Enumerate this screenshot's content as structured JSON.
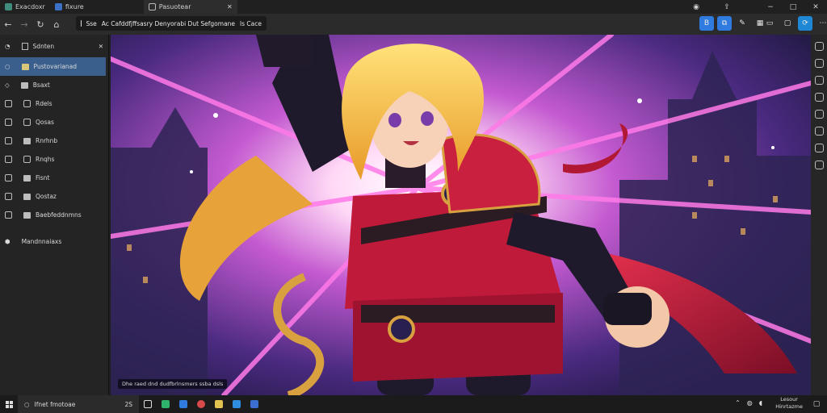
{
  "tabs": [
    {
      "label": "Exacdoxr",
      "active": false
    },
    {
      "label": "fixure",
      "active": false
    },
    {
      "label": "Pasuotear",
      "active": true
    }
  ],
  "tab_close": "✕",
  "window_controls": [
    "−",
    "□",
    "✕"
  ],
  "address": {
    "prefix": "Sse",
    "value": "Ac Cafddfjffsasry Denyorabi Dut Sefgomane",
    "suffix": "ls Cace"
  },
  "sidebar": {
    "header": "Sdnten",
    "items": [
      {
        "label": "Pustovarianad",
        "icon": "folder-icon",
        "selected": true
      },
      {
        "label": "Bsaxt",
        "icon": "pin-icon"
      },
      {
        "label": "Rdels",
        "icon": "file-icon"
      },
      {
        "label": "Qosas",
        "icon": "doc-icon"
      },
      {
        "label": "Rnrhnb",
        "icon": "image-icon"
      },
      {
        "label": "Rnqhs",
        "icon": "doc-icon"
      },
      {
        "label": "Fisnt",
        "icon": "file-icon"
      },
      {
        "label": "Qostaz",
        "icon": "doc-icon"
      },
      {
        "label": "Baebfeddnmns",
        "icon": "image-icon"
      },
      {
        "label": "Mandnnaiaxs",
        "icon": "settings-icon"
      }
    ]
  },
  "viewport_caption": "Dhe raed dnd dudfbrlnsmers ssba dsls",
  "taskbar": {
    "search_label": "Ifnet fmotoae",
    "badge": "2S",
    "clock_line1": "Lesour",
    "clock_line2": "Hinrtazme"
  },
  "colors": {
    "accent": "#3a5f8c",
    "beam": "#ff6ee6",
    "hair": "#f4c64a",
    "armor_red": "#c01a3a"
  }
}
